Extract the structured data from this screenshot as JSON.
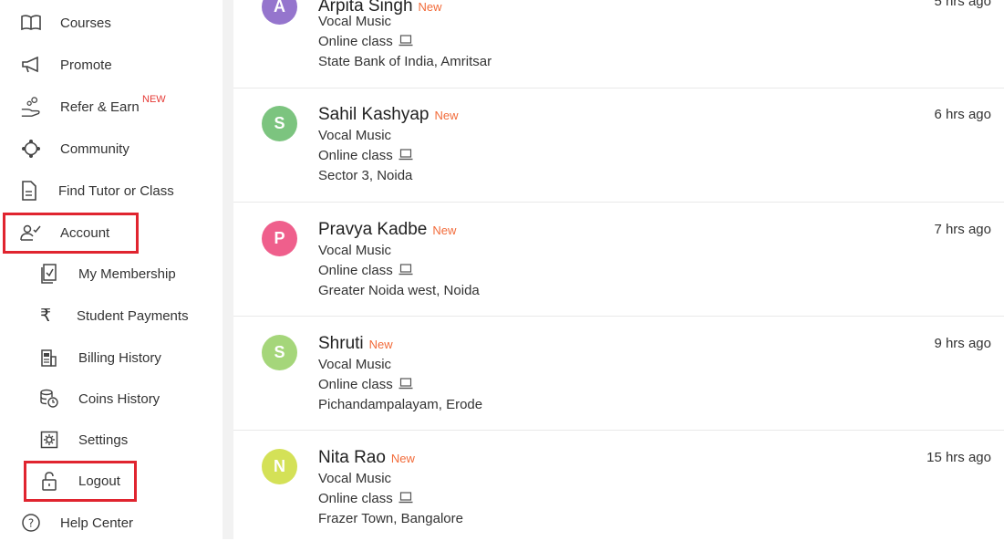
{
  "sidebar": {
    "items": [
      {
        "label": "Courses",
        "icon": "book-icon"
      },
      {
        "label": "Promote",
        "icon": "megaphone-icon"
      },
      {
        "label": "Refer & Earn",
        "icon": "hand-coins-icon",
        "badge": "NEW"
      },
      {
        "label": "Community",
        "icon": "community-icon"
      },
      {
        "label": "Find Tutor or Class",
        "icon": "document-icon"
      },
      {
        "label": "Account",
        "icon": "user-check-icon"
      },
      {
        "label": "My Membership",
        "icon": "membership-icon"
      },
      {
        "label": "Student Payments",
        "icon": "rupee-icon"
      },
      {
        "label": "Billing History",
        "icon": "billing-machine-icon"
      },
      {
        "label": "Coins History",
        "icon": "coins-clock-icon"
      },
      {
        "label": "Settings",
        "icon": "gear-icon"
      },
      {
        "label": "Logout",
        "icon": "unlock-icon"
      },
      {
        "label": "Help Center",
        "icon": "help-icon"
      }
    ]
  },
  "feed": {
    "new_label": "New",
    "items": [
      {
        "initial": "A",
        "name": "Arpita Singh",
        "subject": "Vocal Music",
        "mode": "Online class",
        "location": "State Bank of India, Amritsar",
        "time": "5 hrs ago",
        "color": "#9575cd"
      },
      {
        "initial": "S",
        "name": "Sahil Kashyap",
        "subject": "Vocal Music",
        "mode": "Online class",
        "location": "Sector 3, Noida",
        "time": "6 hrs ago",
        "color": "#7cc47f"
      },
      {
        "initial": "P",
        "name": "Pravya Kadbe",
        "subject": "Vocal Music",
        "mode": "Online class",
        "location": "Greater Noida west, Noida",
        "time": "7 hrs ago",
        "color": "#ef5f8c"
      },
      {
        "initial": "S",
        "name": "Shruti",
        "subject": "Vocal Music",
        "mode": "Online class",
        "location": "Pichandampalayam, Erode",
        "time": "9 hrs ago",
        "color": "#a5d67a"
      },
      {
        "initial": "N",
        "name": "Nita Rao",
        "subject": "Vocal Music",
        "mode": "Online class",
        "location": "Frazer Town, Bangalore",
        "time": "15 hrs ago",
        "color": "#d4e157"
      }
    ]
  },
  "colors": {
    "highlight": "#e0242f",
    "new_tag": "#f26b3a",
    "new_badge": "#e53935"
  }
}
